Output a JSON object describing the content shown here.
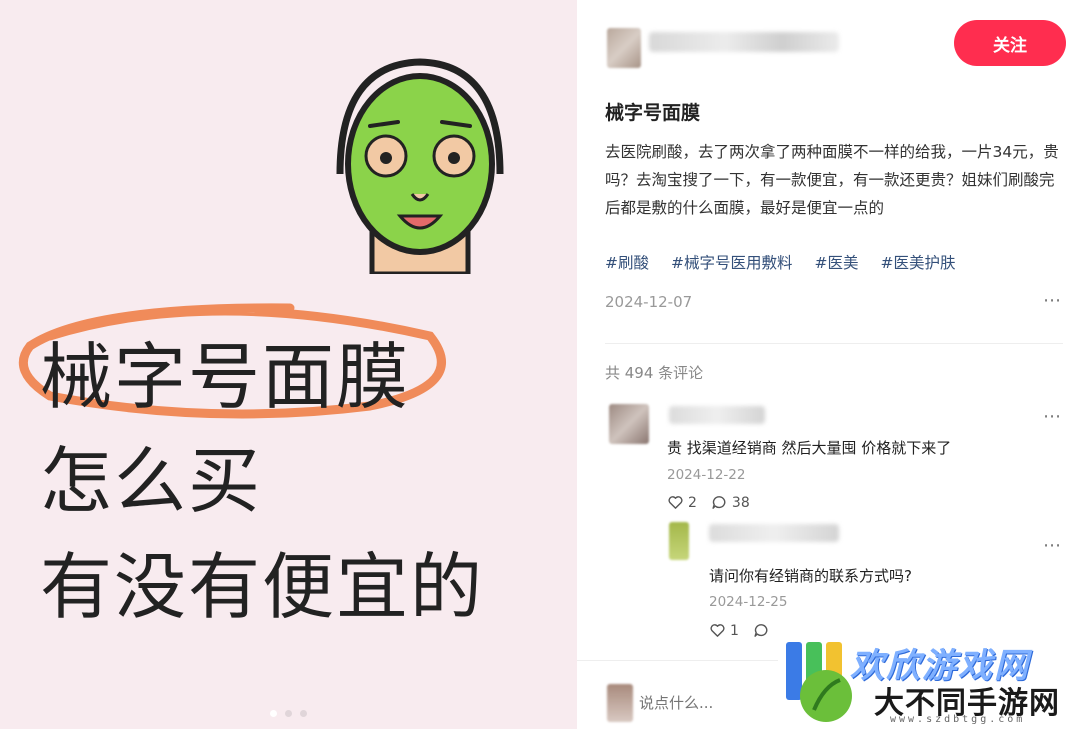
{
  "image_panel": {
    "lines": [
      "械字号面膜",
      "怎么买",
      "有没有便宜的"
    ],
    "carousel_dots": 3,
    "active_dot": 1
  },
  "author": {
    "name": "███ ████",
    "follow_label": "关注"
  },
  "post": {
    "title": "械字号面膜",
    "body": "去医院刷酸，去了两次拿了两种面膜不一样的给我，一片34元，贵吗？去淘宝搜了一下，有一款便宜，有一款还更贵？姐妹们刷酸完后都是敷的什么面膜，最好是便宜一点的",
    "tags": [
      "#刷酸",
      "#械字号医用敷料",
      "#医美",
      "#医美护肤"
    ],
    "date": "2024-12-07",
    "more_icon": "⋯"
  },
  "comments_header": "共 494 条评论",
  "comments": [
    {
      "text": "贵 找渠道经销商 然后大量囤 价格就下来了",
      "date": "2024-12-22",
      "likes": "2",
      "replies": "38"
    },
    {
      "text": "请问你有经销商的联系方式吗?",
      "date": "2024-12-25",
      "likes": "1",
      "replies": ""
    }
  ],
  "input": {
    "placeholder": "说点什么..."
  },
  "watermark": {
    "top": "欢欣游戏网",
    "bottom": "大不同手游网",
    "url": "www.szdbtgg.com"
  },
  "colors": {
    "accent": "#ff2d4f",
    "tag": "#34507a",
    "left_bg": "#f8ebef",
    "mask_green": "#8bd34a",
    "circle_orange": "#f08b5a"
  }
}
